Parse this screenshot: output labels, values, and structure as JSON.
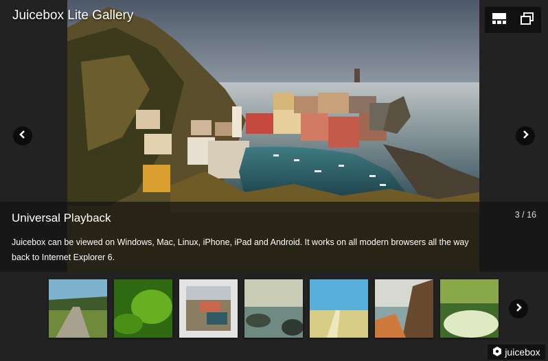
{
  "gallery_title": "Juicebox Lite Gallery",
  "top_buttons": [
    {
      "name": "thumbnails-toggle",
      "icon": "thumbnails-icon"
    },
    {
      "name": "expand",
      "icon": "expand-icon"
    }
  ],
  "caption": {
    "title": "Universal Playback",
    "text": "Juicebox can be viewed on Windows, Mac, Linux, iPhone, iPad and Android. It works on all modern browsers all the way back to Internet Explorer 6.",
    "counter": "3 / 16"
  },
  "thumbnails": [
    {
      "scene": "country-road",
      "selected": false
    },
    {
      "scene": "green-leaves",
      "selected": false
    },
    {
      "scene": "coastal-village",
      "selected": true
    },
    {
      "scene": "rocky-stream",
      "selected": false
    },
    {
      "scene": "beach-path",
      "selected": false
    },
    {
      "scene": "sea-cliffs",
      "selected": false
    },
    {
      "scene": "meadow-flowers",
      "selected": false
    }
  ],
  "brand": {
    "label": "juicebox",
    "icon": "juicebox-logo-icon"
  },
  "colors": {
    "background": "#222222",
    "caption_bg": "#141414",
    "button_bg": "#0c0c0c"
  }
}
